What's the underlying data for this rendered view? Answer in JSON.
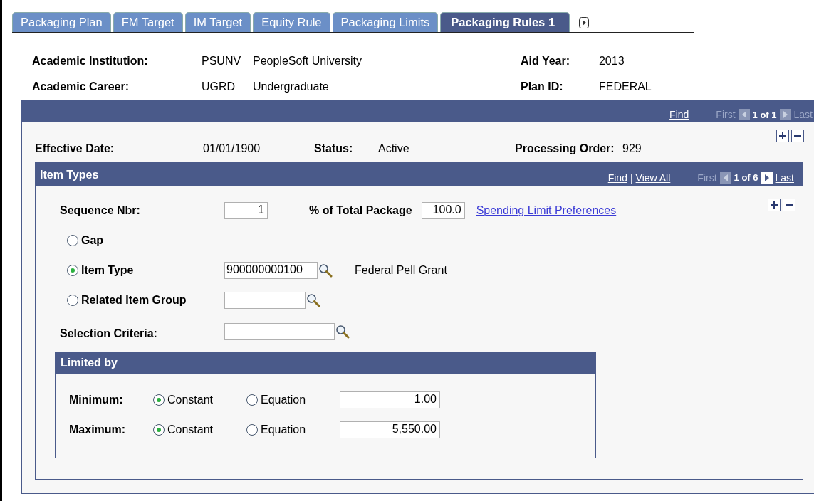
{
  "tabs": [
    {
      "label": "Packaging Plan",
      "selected": false
    },
    {
      "label": "FM Target",
      "selected": false
    },
    {
      "label": "IM Target",
      "selected": false
    },
    {
      "label": "Equity Rule",
      "selected": false
    },
    {
      "label": "Packaging Limits",
      "selected": false
    },
    {
      "label": "Packaging Rules 1",
      "selected": true
    }
  ],
  "header": {
    "left": [
      {
        "label": "Academic Institution:",
        "code": "PSUNV",
        "value": "PeopleSoft University"
      },
      {
        "label": "Academic Career:",
        "code": "UGRD",
        "value": "Undergraduate"
      }
    ],
    "right": [
      {
        "label": "Aid Year:",
        "value": "2013"
      },
      {
        "label": "Plan ID:",
        "value": "FEDERAL"
      }
    ]
  },
  "rules_nav": {
    "find": "Find",
    "first": "First",
    "first_disabled": true,
    "count": "1 of 1",
    "last": "Last",
    "last_disabled": true
  },
  "rules_row": [
    {
      "label": "Effective Date:",
      "value": "01/01/1900"
    },
    {
      "label": "Status:",
      "value": "Active"
    },
    {
      "label": "Processing Order:",
      "value": "929"
    }
  ],
  "item_types": {
    "title": "Item Types",
    "nav": {
      "find": "Find",
      "separator": "|",
      "view_all": "View All",
      "first": "First",
      "first_disabled": true,
      "count": "1 of 6",
      "last": "Last",
      "last_disabled": false
    },
    "sequence_label": "Sequence Nbr:",
    "sequence_value": "1",
    "percent_label": "% of Total Package",
    "percent_value": "100.0",
    "link": "Spending Limit Preferences",
    "options": [
      {
        "kind": "plain",
        "label": "Gap",
        "selected": false
      },
      {
        "kind": "lookup",
        "label": "Item Type",
        "selected": true,
        "value": "900000000100",
        "description": "Federal Pell Grant"
      },
      {
        "kind": "lookup",
        "label": "Related Item Group",
        "selected": false
      }
    ],
    "selection_label": "Selection Criteria:",
    "limited_by": {
      "title": "Limited by",
      "rows": [
        {
          "label": "Minimum:",
          "options": [
            {
              "label": "Constant",
              "selected": true
            },
            {
              "label": "Equation",
              "selected": false
            }
          ],
          "value": "1.00"
        },
        {
          "label": "Maximum:",
          "options": [
            {
              "label": "Constant",
              "selected": true
            },
            {
              "label": "Equation",
              "selected": false
            }
          ],
          "value": "5,550.00"
        }
      ]
    }
  }
}
